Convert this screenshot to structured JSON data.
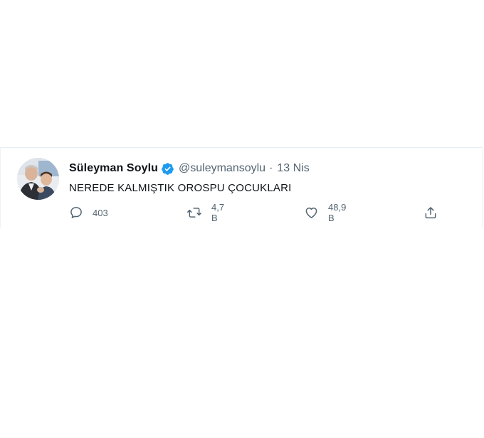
{
  "tweet": {
    "author": {
      "display_name": "Süleyman Soylu",
      "handle": "@suleymansoylu",
      "verified": true
    },
    "separator": "·",
    "date": "13 Nis",
    "text": "NEREDE KALMIŞTIK OROSPU ÇOCUKLARI",
    "actions": {
      "reply_count": "403",
      "retweet_count": "4,7 B",
      "like_count": "48,9 B"
    }
  },
  "icons": {
    "reply": "reply-bubble-icon",
    "retweet": "retweet-icon",
    "like": "heart-icon",
    "share": "share-icon",
    "verified": "verified-badge-icon"
  },
  "colors": {
    "verified_blue": "#1d9bf0",
    "text_primary": "#0f1419",
    "text_secondary": "#536471"
  }
}
